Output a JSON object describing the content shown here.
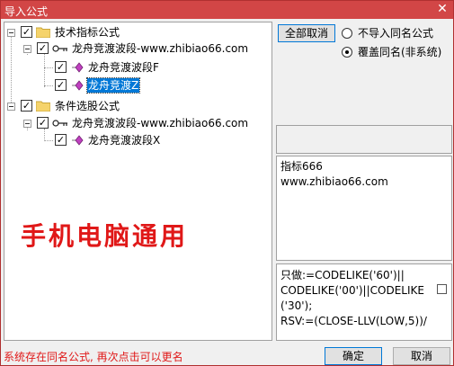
{
  "window": {
    "title": "导入公式",
    "close_glyph": "✕"
  },
  "tree": {
    "groups": [
      {
        "label": "技术指标公式",
        "checked": true,
        "site": {
          "label": "龙舟竞渡波段-www.zhibiao66.com",
          "checked": true
        },
        "items": [
          {
            "label": "龙舟竞渡波段F",
            "checked": true,
            "selected": false
          },
          {
            "label": "龙舟竞渡Z",
            "checked": true,
            "selected": true
          }
        ]
      },
      {
        "label": "条件选股公式",
        "checked": true,
        "site": {
          "label": "龙舟竞渡波段-www.zhibiao66.com",
          "checked": true
        },
        "items": [
          {
            "label": "龙舟竞渡波段X",
            "checked": true,
            "selected": false
          }
        ]
      }
    ],
    "check_glyph": "✓",
    "icons": {
      "group": "folder-icon",
      "site": "key-icon",
      "item": "formula-diamond-icon"
    }
  },
  "overlay": {
    "slogan": "手机电脑通用"
  },
  "options": {
    "cancel_all_label": "全部取消",
    "radio_options": [
      {
        "label": "不导入同名公式",
        "selected": false
      },
      {
        "label": "覆盖同名(非系统)",
        "selected": true
      }
    ]
  },
  "info": {
    "line1": "指标666",
    "line2": "www.zhibiao66.com"
  },
  "formula": {
    "line1": "只做:=CODELIKE('60')||",
    "line2": "CODELIKE('00')||CODELIKE",
    "line3": "('30');",
    "line4": "RSV:=(CLOSE-LLV(LOW,5))/"
  },
  "footer": {
    "status": "系统存在同名公式, 再次点击可以更名",
    "ok_label": "确定",
    "cancel_label": "取消"
  },
  "colors": {
    "title_bar": "#d24646",
    "selection": "#0078d7",
    "slogan": "#e01818",
    "status": "#e01818"
  }
}
